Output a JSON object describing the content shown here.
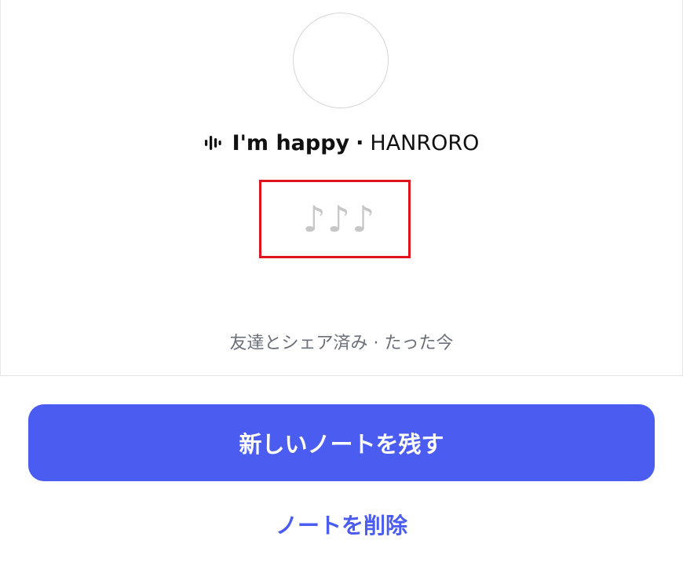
{
  "avatar": {
    "alt": "profile avatar"
  },
  "music": {
    "icon": "sound-wave-icon",
    "song_title": "I'm happy",
    "separator": "·",
    "artist": "HANRORO"
  },
  "note": {
    "text": "♪♪♪"
  },
  "status": {
    "shared_text": "友達とシェア済み · たった今"
  },
  "actions": {
    "primary_label": "新しいノートを残す",
    "delete_label": "ノートを削除"
  },
  "colors": {
    "accent": "#4b5cf0",
    "highlight": "#e0141e",
    "note_text": "#c7c7c7",
    "muted_text": "#6a6f78"
  }
}
